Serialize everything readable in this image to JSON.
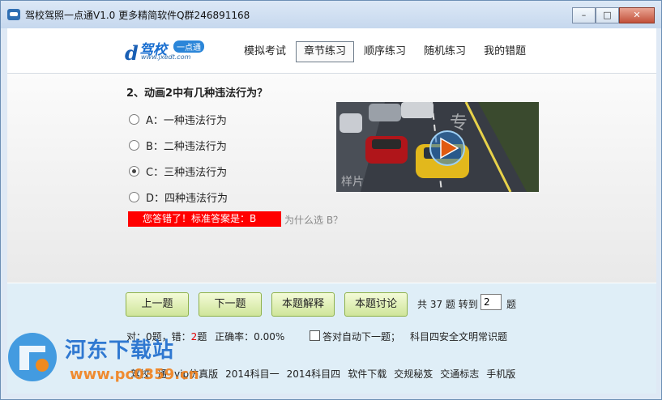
{
  "window": {
    "title": "驾校驾照一点通V1.0   更多精简软件Q群246891168",
    "minimize": "–",
    "maximize": "□",
    "close": "✕"
  },
  "logo": {
    "main": "驾校",
    "sub": "一点通",
    "url": "www.jxedt.com",
    "d": "d"
  },
  "nav": {
    "tabs": [
      "模拟考试",
      "章节练习",
      "顺序练习",
      "随机练习",
      "我的错题"
    ],
    "active": "章节练习"
  },
  "question": {
    "text": "2、动画2中有几种违法行为？",
    "options": [
      {
        "label": "A：一种违法行为",
        "selected": false
      },
      {
        "label": "B：二种违法行为",
        "selected": false
      },
      {
        "label": "C：三种违法行为",
        "selected": true
      },
      {
        "label": "D：四种违法行为",
        "selected": false
      }
    ],
    "feedback": "您答错了！标准答案是：B",
    "why": "为什么选 B？"
  },
  "video": {
    "caption": "样片",
    "road_text": "专"
  },
  "controls": {
    "prev": "上一题",
    "next": "下一题",
    "explain": "本题解释",
    "discuss": "本题讨论",
    "total_text": "共 37 题 转到",
    "goto_value": "2",
    "total_unit": "题"
  },
  "stats": {
    "right_label": "对：",
    "right_value": "0",
    "right_unit": "题，错：",
    "wrong_value": "2",
    "wrong_unit": "题",
    "accuracy": "正确率：0.00%",
    "auto_next": "答对自动下一题；",
    "subject": "科目四安全文明常识题"
  },
  "links": [
    "驾校",
    "通",
    "vip仿真版",
    "2014科目一",
    "2014科目四",
    "软件下载",
    "交规秘笈",
    "交通标志",
    "手机版"
  ],
  "watermark": {
    "text": "河东下载站",
    "url": "www.pc0359.cn"
  },
  "colors": {
    "answer_bar": "#ff0000",
    "button": "#cfe59a",
    "bottom_panel": "#dfeef7"
  }
}
